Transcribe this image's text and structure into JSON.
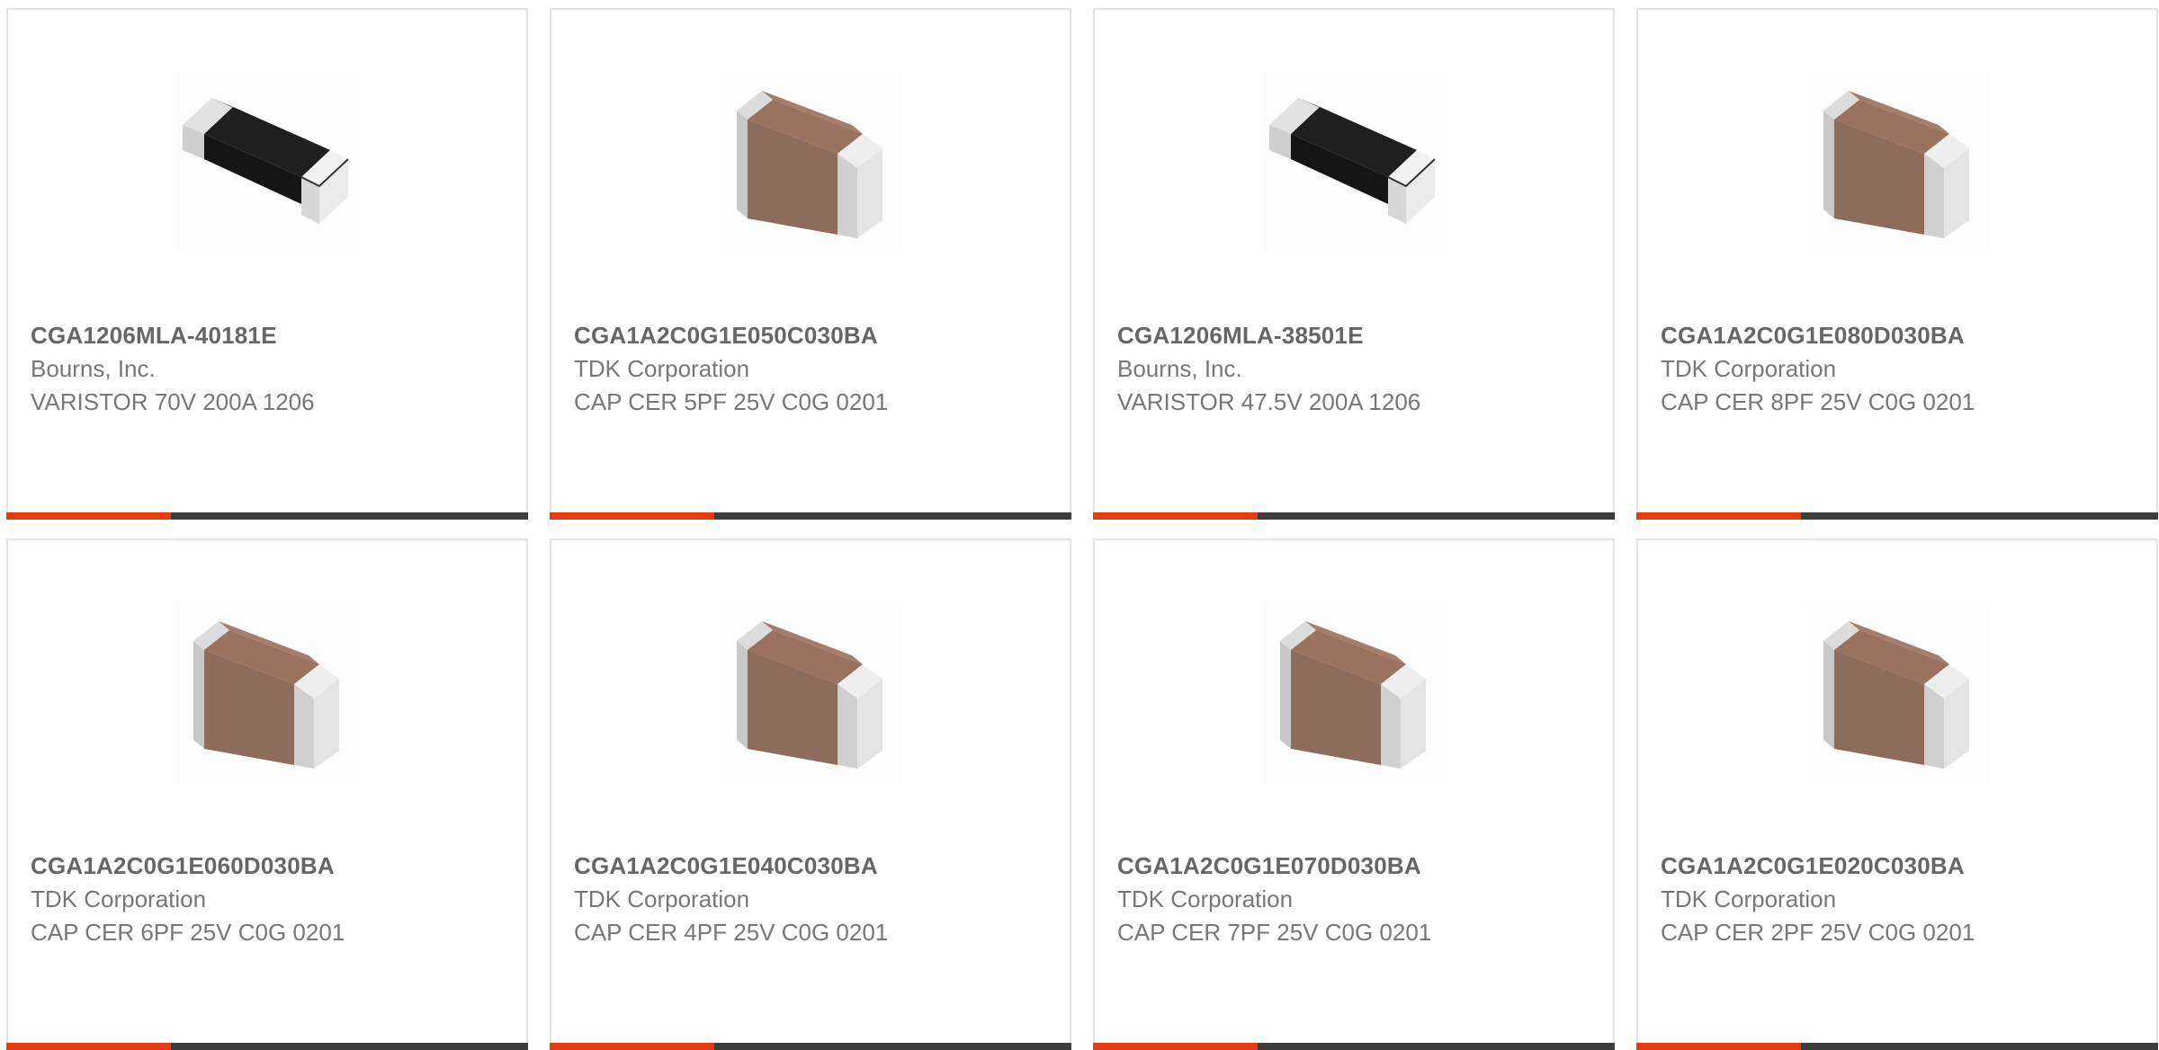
{
  "colors": {
    "accent_bar": "#e63a10",
    "dark_bar": "#3d3d3d",
    "card_border": "#e3e3e3",
    "part_number_text": "#666666",
    "secondary_text": "#777777"
  },
  "products": [
    {
      "part_number": "CGA1206MLA-40181E",
      "manufacturer": "Bourns, Inc.",
      "description": "VARISTOR 70V 200A 1206",
      "image": "varistor-chip-icon"
    },
    {
      "part_number": "CGA1A2C0G1E050C030BA",
      "manufacturer": "TDK Corporation",
      "description": "CAP CER 5PF 25V C0G 0201",
      "image": "ceramic-capacitor-icon"
    },
    {
      "part_number": "CGA1206MLA-38501E",
      "manufacturer": "Bourns, Inc.",
      "description": "VARISTOR 47.5V 200A 1206",
      "image": "varistor-chip-icon"
    },
    {
      "part_number": "CGA1A2C0G1E080D030BA",
      "manufacturer": "TDK Corporation",
      "description": "CAP CER 8PF 25V C0G 0201",
      "image": "ceramic-capacitor-icon"
    },
    {
      "part_number": "CGA1A2C0G1E060D030BA",
      "manufacturer": "TDK Corporation",
      "description": "CAP CER 6PF 25V C0G 0201",
      "image": "ceramic-capacitor-icon"
    },
    {
      "part_number": "CGA1A2C0G1E040C030BA",
      "manufacturer": "TDK Corporation",
      "description": "CAP CER 4PF 25V C0G 0201",
      "image": "ceramic-capacitor-icon"
    },
    {
      "part_number": "CGA1A2C0G1E070D030BA",
      "manufacturer": "TDK Corporation",
      "description": "CAP CER 7PF 25V C0G 0201",
      "image": "ceramic-capacitor-icon"
    },
    {
      "part_number": "CGA1A2C0G1E020C030BA",
      "manufacturer": "TDK Corporation",
      "description": "CAP CER 2PF 25V C0G 0201",
      "image": "ceramic-capacitor-icon"
    }
  ]
}
